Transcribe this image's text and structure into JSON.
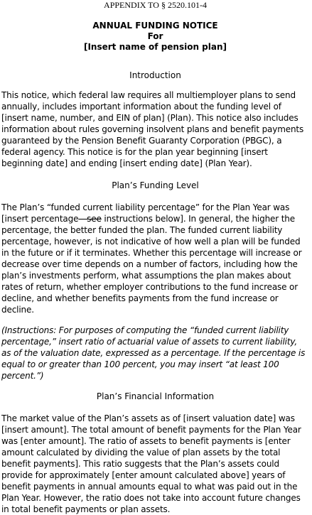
{
  "header": {
    "appendix": "APPENDIX TO § 2520.101-4",
    "title": "ANNUAL FUNDING NOTICE",
    "for": "For",
    "plan_name": "[Insert name of pension plan]"
  },
  "intro": {
    "heading": "Introduction",
    "text": "This notice, which federal law requires all multiemployer plans to send annually, includes important information about the funding level of [insert name, number, and EIN of plan] (Plan).  This notice also includes information about rules governing insolvent plans and benefit payments guaranteed by the Pension Benefit Guaranty Corporation (PBGC), a federal agency.  This notice is for the plan year beginning [insert beginning date] and ending [insert ending date] (Plan Year)."
  },
  "funding": {
    "heading": "Plan’s Funding Level",
    "text_before": "The Plan’s “funded current liability percentage” for the Plan Year was [insert percentage",
    "struck": "—see",
    "text_after": " instructions below].  In general, the higher the percentage, the better funded the plan.  The funded current liability percentage, however, is not indicative of how well a plan will be funded in the future or if it terminates.  Whether this percentage will increase or decrease over time depends on a number of factors, including how the plan’s investments perform, what assumptions the plan makes about rates of return, whether employer contributions to the fund increase or decline, and whether benefits payments from the fund increase or decline.",
    "instructions": "(Instructions: For purposes of computing the “funded current liability percentage,” insert ratio of actuarial value of assets to current liability, as of the valuation date, expressed as a percentage.  If the percentage is equal to or greater than 100 percent, you may insert “at least 100 percent.”)"
  },
  "financial": {
    "heading": "Plan’s Financial Information",
    "text": "The market value of the Plan’s assets as of [insert valuation date] was [insert amount].  The total amount of benefit payments for the Plan Year was [enter amount].  The ratio of assets to benefit payments is [enter amount calculated by dividing the value of plan assets by the total benefit payments].  This ratio suggests that the Plan’s assets could provide for approximately [enter amount calculated above] years of benefit payments in annual amounts equal to what was paid out in the Plan Year.  However, the ratio does not take into account future changes in total benefit payments or plan assets."
  }
}
